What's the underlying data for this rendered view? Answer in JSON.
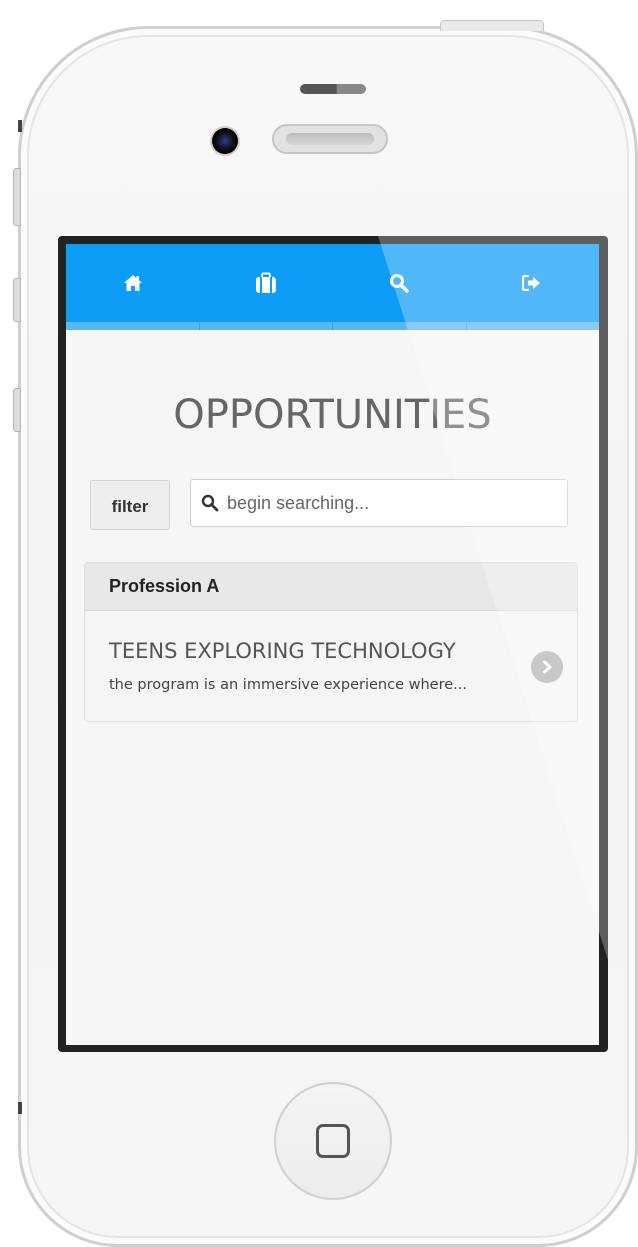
{
  "nav": {
    "items": [
      {
        "icon": "home-icon",
        "label": "Home"
      },
      {
        "icon": "briefcase-icon",
        "label": "Opportunities"
      },
      {
        "icon": "search-icon",
        "label": "Search"
      },
      {
        "icon": "sign-out-icon",
        "label": "Sign out"
      }
    ],
    "colors": {
      "bar": "#0d9cf6",
      "underline": "#59b9f8"
    }
  },
  "page": {
    "title": "OPPORTUNITIES"
  },
  "filter": {
    "label": "filter"
  },
  "search": {
    "placeholder": "begin searching..."
  },
  "results": {
    "groups": [
      {
        "heading": "Profession A",
        "items": [
          {
            "title": "TEENS EXPLORING TECHNOLOGY",
            "description": "the program is an immersive experience where..."
          }
        ]
      }
    ]
  }
}
